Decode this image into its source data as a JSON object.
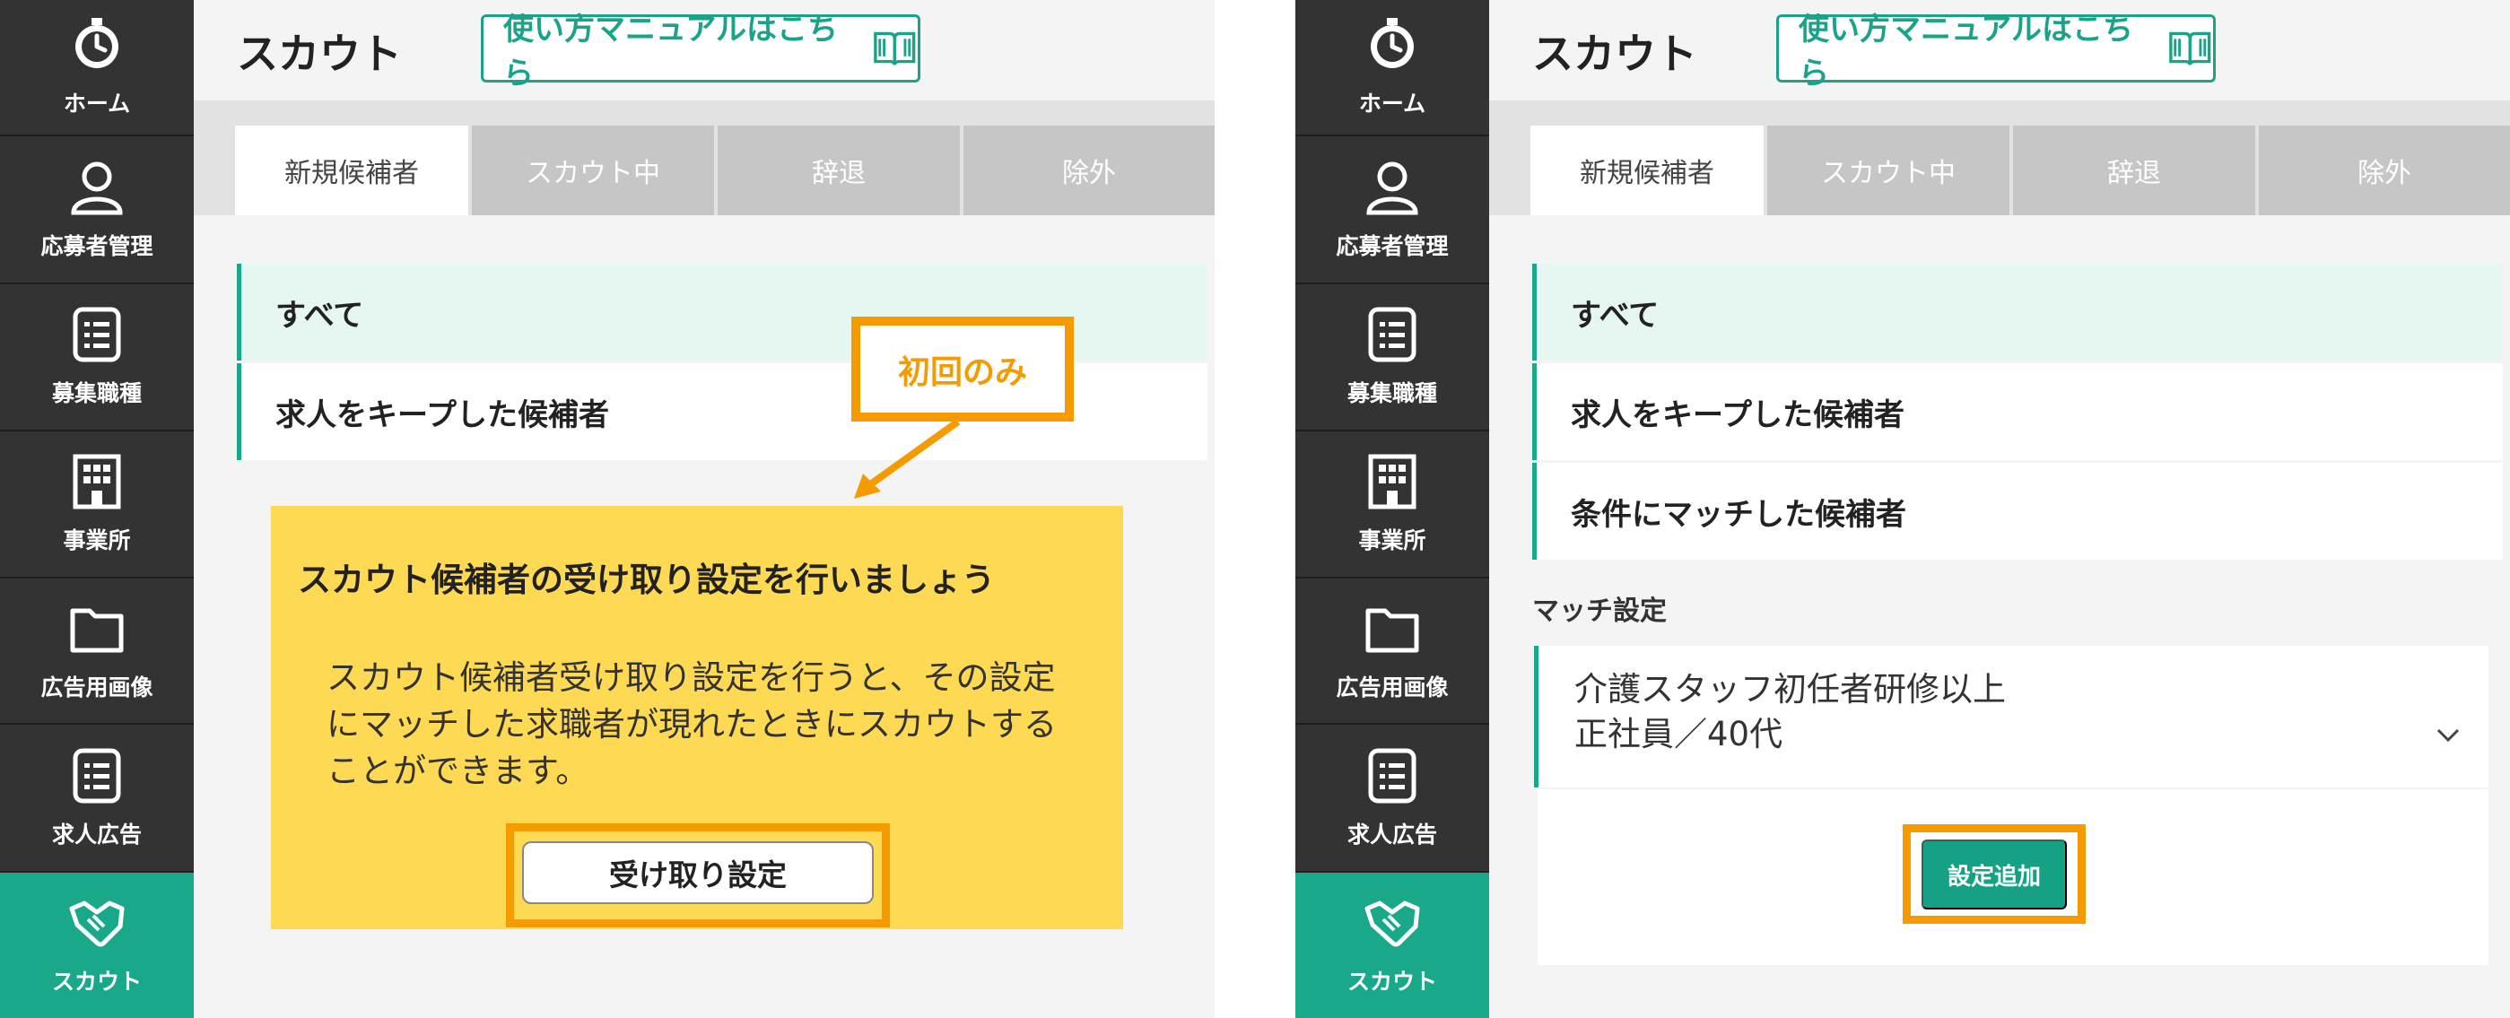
{
  "sidebar": {
    "items": [
      {
        "label": "ホーム",
        "icon": "home-timer-icon"
      },
      {
        "label": "応募者管理",
        "icon": "person-icon"
      },
      {
        "label": "募集職種",
        "icon": "list-icon"
      },
      {
        "label": "事業所",
        "icon": "building-icon"
      },
      {
        "label": "広告用画像",
        "icon": "folder-icon"
      },
      {
        "label": "求人広告",
        "icon": "list-icon"
      },
      {
        "label": "スカウト",
        "icon": "handshake-icon"
      }
    ]
  },
  "header": {
    "title": "スカウト",
    "manual_link": "使い方マニュアルはこちら",
    "manual_icon": "book-icon"
  },
  "tabs": [
    {
      "label": "新規候補者",
      "active": true
    },
    {
      "label": "スカウト中",
      "active": false
    },
    {
      "label": "辞退",
      "active": false
    },
    {
      "label": "除外",
      "active": false
    }
  ],
  "left_panel": {
    "filters": [
      {
        "label": "すべて"
      },
      {
        "label": "求人をキープした候補者"
      }
    ],
    "badge": "初回のみ",
    "callout": {
      "title": "スカウト候補者の受け取り設定を行いましょう",
      "description": "スカウト候補者受け取り設定を行うと、その設定にマッチした求職者が現れたときにスカウトすることができます。",
      "button": "受け取り設定"
    }
  },
  "right_panel": {
    "filters": [
      {
        "label": "すべて"
      },
      {
        "label": "求人をキープした候補者"
      },
      {
        "label": "条件にマッチした候補者"
      }
    ],
    "match_heading": "マッチ設定",
    "match_line1": "介護スタッフ初任者研修以上",
    "match_line2": "正社員／40代",
    "add_button": "設定追加"
  },
  "colors": {
    "sidebar_bg": "#333333",
    "accent": "#19a88a",
    "highlight": "#f59b00",
    "callout_bg": "#fed954"
  }
}
